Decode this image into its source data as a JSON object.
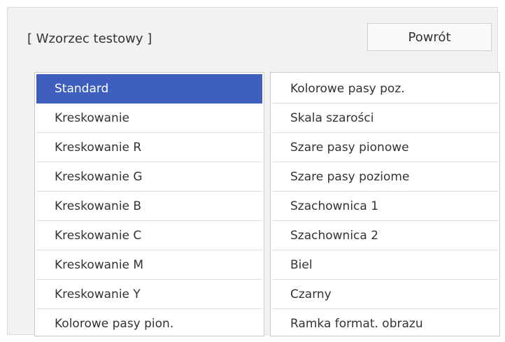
{
  "header": {
    "title": "[ Wzorzec testowy ]",
    "back_label": "Powrót"
  },
  "selected": "Standard",
  "left_items": [
    {
      "label": "Standard"
    },
    {
      "label": "Kreskowanie"
    },
    {
      "label": "Kreskowanie R"
    },
    {
      "label": "Kreskowanie G"
    },
    {
      "label": "Kreskowanie B"
    },
    {
      "label": "Kreskowanie C"
    },
    {
      "label": "Kreskowanie M"
    },
    {
      "label": "Kreskowanie Y"
    },
    {
      "label": "Kolorowe pasy pion."
    }
  ],
  "right_items": [
    {
      "label": "Kolorowe pasy poz."
    },
    {
      "label": "Skala szarości"
    },
    {
      "label": "Szare pasy pionowe"
    },
    {
      "label": "Szare pasy poziome"
    },
    {
      "label": "Szachownica 1"
    },
    {
      "label": "Szachownica 2"
    },
    {
      "label": "Biel"
    },
    {
      "label": "Czarny"
    },
    {
      "label": "Ramka format. obrazu"
    }
  ],
  "colors": {
    "accent": "#3f5fbf",
    "panel_bg": "#f2f2f2"
  }
}
